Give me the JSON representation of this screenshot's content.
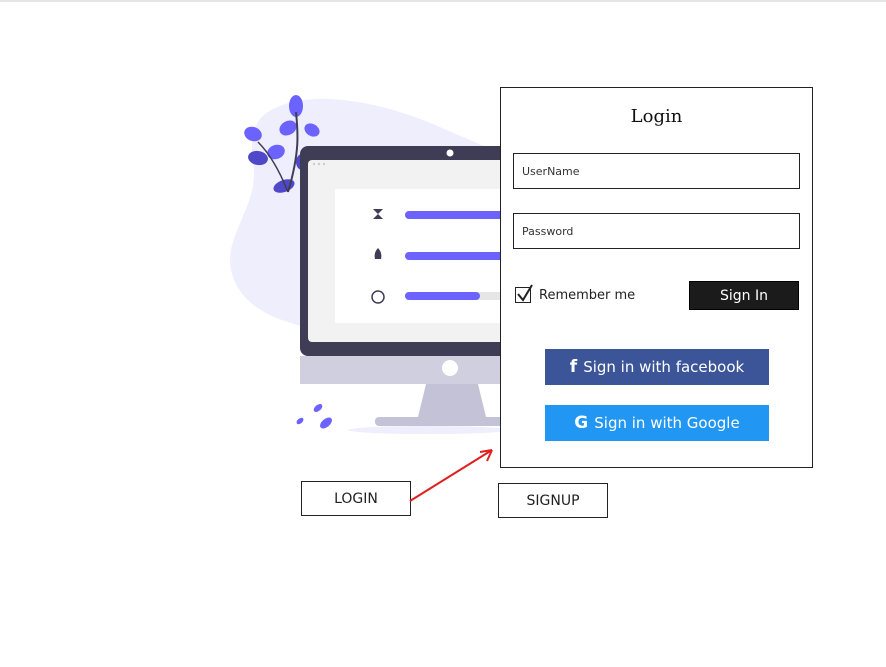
{
  "login_panel": {
    "title": "Login",
    "username_placeholder": "UserName",
    "password_placeholder": "Password",
    "remember_label": "Remember me",
    "remember_checked": true,
    "signin_label": "Sign In",
    "facebook_icon_glyph": "f",
    "facebook_label": "Sign in with facebook",
    "google_icon_glyph": "G",
    "google_label": "Sign in with Google"
  },
  "wireframe": {
    "login_label": "LOGIN",
    "signup_label": "SIGNUP"
  },
  "colors": {
    "facebook": "#3b5598",
    "google": "#2196f3",
    "accent": "#6c63ff",
    "arrow": "#e02020"
  }
}
